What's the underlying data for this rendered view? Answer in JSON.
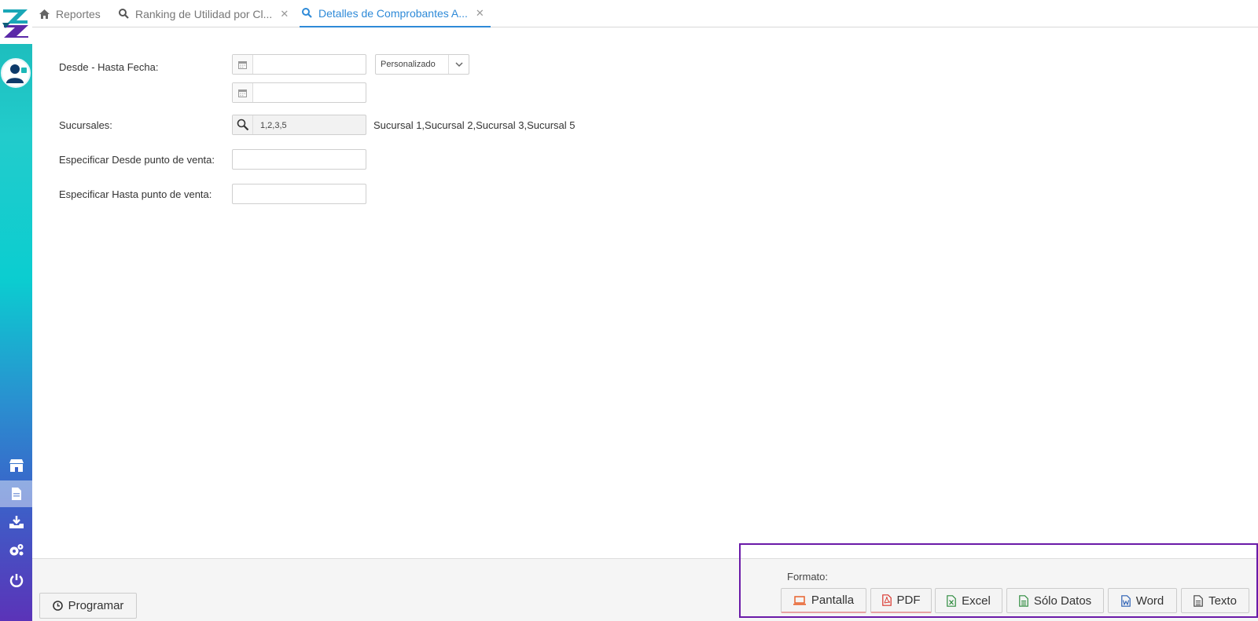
{
  "tabs": [
    {
      "label": "Reportes",
      "icon": "home-icon"
    },
    {
      "label": "Ranking de Utilidad por Cl...",
      "icon": "search-icon",
      "closable": true
    },
    {
      "label": "Detalles de Comprobantes A...",
      "icon": "search-icon",
      "closable": true,
      "active": true
    }
  ],
  "form": {
    "fecha_label": "Desde - Hasta Fecha:",
    "fecha_desde": "",
    "fecha_hasta": "",
    "periodo_select": "Personalizado",
    "sucursales_label": "Sucursales:",
    "sucursales_value": "1,2,3,5",
    "sucursales_desc": "Sucursal 1,Sucursal 2,Sucursal 3,Sucursal 5",
    "desde_pv_label": "Especificar Desde punto de venta:",
    "desde_pv_value": "",
    "hasta_pv_label": "Especificar Hasta punto de venta:",
    "hasta_pv_value": ""
  },
  "bottom": {
    "programar_label": "Programar",
    "formato_label": "Formato:",
    "formats": [
      {
        "label": "Pantalla",
        "icon": "monitor-icon",
        "color": "#e8622c"
      },
      {
        "label": "PDF",
        "icon": "pdf-icon",
        "color": "#d9342b"
      },
      {
        "label": "Excel",
        "icon": "excel-icon",
        "color": "#2e8b3e"
      },
      {
        "label": "Sólo Datos",
        "icon": "data-file-icon",
        "color": "#2e8b3e"
      },
      {
        "label": "Word",
        "icon": "word-icon",
        "color": "#2b5fb4"
      },
      {
        "label": "Texto",
        "icon": "text-file-icon",
        "color": "#444444"
      }
    ]
  },
  "colors": {
    "accent": "#2e8ad8",
    "highlight_box": "#6a1aa8"
  }
}
